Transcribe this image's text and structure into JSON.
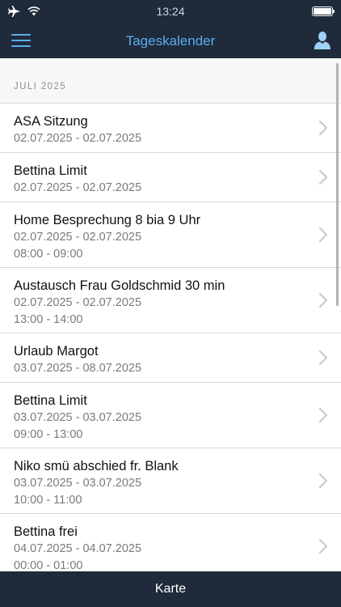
{
  "status_bar": {
    "time": "13:24",
    "icons": [
      "airplane-icon",
      "wifi-icon",
      "battery-icon"
    ],
    "battery_level": 1.0
  },
  "nav_bar": {
    "title": "Tageskalender",
    "left_icon": "hamburger-menu-icon",
    "right_icon": "user-icon"
  },
  "section": {
    "header": "JULI 2025"
  },
  "events": [
    {
      "title": "ASA Sitzung",
      "dates": "02.07.2025 - 02.07.2025",
      "time": ""
    },
    {
      "title": "Bettina Limit",
      "dates": "02.07.2025 - 02.07.2025",
      "time": ""
    },
    {
      "title": "Home Besprechung 8 bia 9 Uhr",
      "dates": "02.07.2025 - 02.07.2025",
      "time": "08:00 - 09:00"
    },
    {
      "title": "Austausch Frau Goldschmid 30 min",
      "dates": "02.07.2025 - 02.07.2025",
      "time": "13:00 - 14:00"
    },
    {
      "title": "Urlaub Margot",
      "dates": "03.07.2025 - 08.07.2025",
      "time": ""
    },
    {
      "title": "Bettina Limit",
      "dates": "03.07.2025 - 03.07.2025",
      "time": "09:00 - 13:00"
    },
    {
      "title": "Niko smü abschied fr. Blank",
      "dates": "03.07.2025 - 03.07.2025",
      "time": "10:00 - 11:00"
    },
    {
      "title": "Bettina frei",
      "dates": "04.07.2025 - 04.07.2025",
      "time": "00:00 - 01:00"
    }
  ],
  "bottom_bar": {
    "label": "Karte"
  },
  "colors": {
    "bar_background": "#1f2a3a",
    "accent": "#5aaef0",
    "title_text": "#111111",
    "subtitle_text": "#7a7a7a",
    "separator": "#d9d9d9",
    "section_background": "#f7f7f7",
    "chevron": "#c7c7cc"
  }
}
